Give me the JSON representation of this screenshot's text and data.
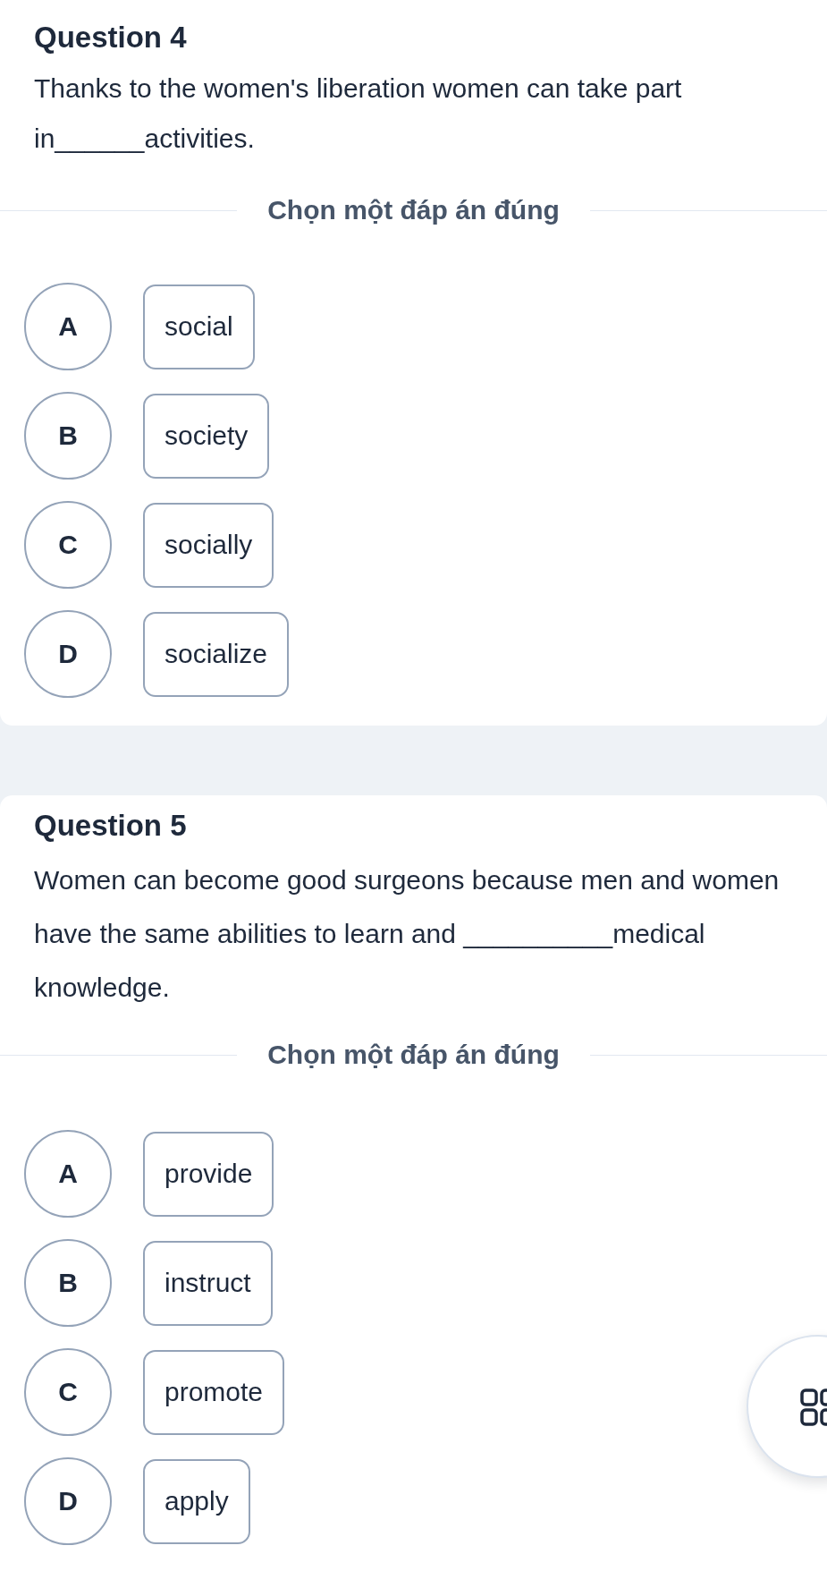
{
  "questions": [
    {
      "title": "Question 4",
      "text": "Thanks to the women's liberation women can take part in______activities.",
      "instruction": "Chọn một đáp án đúng",
      "options": [
        {
          "letter": "A",
          "text": "social"
        },
        {
          "letter": "B",
          "text": "society"
        },
        {
          "letter": "C",
          "text": "socially"
        },
        {
          "letter": "D",
          "text": "socialize"
        }
      ]
    },
    {
      "title": "Question 5",
      "text": "Women can become good surgeons because men and women have the same abilities to learn and __________medical knowledge.",
      "instruction": "Chọn một đáp án đúng",
      "options": [
        {
          "letter": "A",
          "text": "provide"
        },
        {
          "letter": "B",
          "text": "instruct"
        },
        {
          "letter": "C",
          "text": "promote"
        },
        {
          "letter": "D",
          "text": "apply"
        }
      ]
    }
  ]
}
